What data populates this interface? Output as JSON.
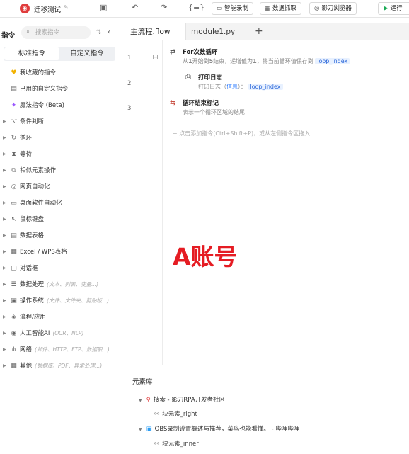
{
  "app": {
    "title": "迁移测试"
  },
  "toolbar": {
    "smart_record": "智能录制",
    "data_capture": "数据抓取",
    "browser": "影刀浏览器",
    "run": "运行"
  },
  "sidebar": {
    "title": "指令",
    "search_placeholder": "搜索指令",
    "tabs": {
      "standard": "标准指令",
      "custom": "自定义指令"
    },
    "items": [
      {
        "label": "我收藏的指令",
        "sub": ""
      },
      {
        "label": "已用的自定义指令",
        "sub": ""
      },
      {
        "label": "魔法指令 (Beta)",
        "sub": ""
      },
      {
        "label": "条件判断",
        "sub": ""
      },
      {
        "label": "循环",
        "sub": ""
      },
      {
        "label": "等待",
        "sub": ""
      },
      {
        "label": "相似元素操作",
        "sub": ""
      },
      {
        "label": "网页自动化",
        "sub": ""
      },
      {
        "label": "桌面软件自动化",
        "sub": ""
      },
      {
        "label": "鼠标键盘",
        "sub": ""
      },
      {
        "label": "数据表格",
        "sub": ""
      },
      {
        "label": "Excel / WPS表格",
        "sub": ""
      },
      {
        "label": "对话框",
        "sub": ""
      },
      {
        "label": "数据处理",
        "sub": "(文本、列表、变量...)"
      },
      {
        "label": "操作系统",
        "sub": "(文件、文件夹、剪贴板...)"
      },
      {
        "label": "流程/应用",
        "sub": ""
      },
      {
        "label": "人工智能AI",
        "sub": "(OCR、NLP)"
      },
      {
        "label": "网络",
        "sub": "(邮件、HTTP、FTP、数据职...)"
      },
      {
        "label": "其他",
        "sub": "(数据库、PDF、异常处理...)"
      }
    ]
  },
  "editor": {
    "tabs": [
      "主流程.flow",
      "module1.py"
    ],
    "line_numbers": [
      "1",
      "2",
      "3"
    ],
    "nodes": {
      "loop_title": "For次数循环",
      "loop_desc_a": "从",
      "loop_n1": "1",
      "loop_desc_b": "开始到",
      "loop_n2": "5",
      "loop_desc_c": "结束，递增值为",
      "loop_n3": "1",
      "loop_desc_d": "，将当前循环值保存到",
      "loop_var": "loop_index",
      "log_title": "打印日志",
      "log_desc": "打印日志（",
      "log_level": "信息",
      "log_desc2": "）：",
      "log_var": "loop_index",
      "end_title": "循环结束标记",
      "end_desc": "表示一个循环区域的结尾"
    },
    "add_hint": "+ 点击添加指令(Ctrl+Shift+P)，或从左侧指令区拖入",
    "watermark": "A账号"
  },
  "elements": {
    "title": "元素库",
    "groups": [
      {
        "label": "搜索 - 影刀RPA开发者社区",
        "child": "块元素_right"
      },
      {
        "label": "OBS录制设置概述与推荐，菜鸟也能看懂。 - 哔哩哔哩",
        "child": "块元素_inner"
      }
    ]
  },
  "colors": {
    "accent": "#2563d8",
    "watermark": "#e51c23",
    "run": "#1aaa55"
  }
}
